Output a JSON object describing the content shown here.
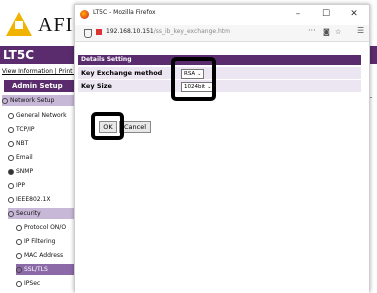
{
  "background": {
    "logo_text": "AFIN",
    "product_title": "LT5C",
    "top_links": "View Information | Print Inf",
    "admin_label": "Admin Setup",
    "nav": [
      {
        "label": "Network Setup"
      },
      {
        "label": "General Network"
      },
      {
        "label": "TCP/IP"
      },
      {
        "label": "NBT"
      },
      {
        "label": "Email"
      },
      {
        "label": "SNMP"
      },
      {
        "label": "IPP"
      },
      {
        "label": "IEEE802.1X"
      },
      {
        "label": "Security"
      },
      {
        "label": "Protocol ON/O"
      },
      {
        "label": "IP Filtering"
      },
      {
        "label": "MAC Address"
      },
      {
        "label": "SSL/TLS"
      },
      {
        "label": "IPSec"
      }
    ]
  },
  "window": {
    "title": "LT5C - Mozilla Firefox",
    "url_host": "192.168.10.151",
    "url_path": "/ss_ib_key_exchange.htm",
    "controls": {
      "minimize": "–",
      "maximize": "☐",
      "close": "✕"
    },
    "url_more": "···",
    "url_menu": "☰"
  },
  "details": {
    "section_title": "Details Setting",
    "key_exchange_label": "Key Exchange method",
    "key_exchange_value": "RSA",
    "key_size_label": "Key Size",
    "key_size_value": "1024bit",
    "ok_label": "OK",
    "cancel_label": "Cancel"
  },
  "colors": {
    "accent": "#5a2c6e",
    "row_bg": "#ece6f2",
    "highlight_box": "#000000"
  }
}
